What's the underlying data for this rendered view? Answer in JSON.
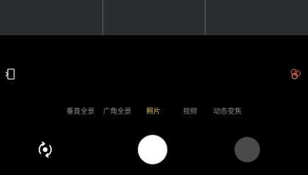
{
  "camera": {
    "modes": [
      {
        "label": "垂直全景"
      },
      {
        "label": "广角全景"
      },
      {
        "label": "照片"
      },
      {
        "label": "视频"
      },
      {
        "label": "动态变焦"
      }
    ],
    "active_mode": "照片",
    "colors": {
      "background": "#000000",
      "viewfinder": "#2a2e33",
      "mode_inactive": "#8d8d8d",
      "mode_active": "#e9c84a",
      "filter_icon": "#e0502a",
      "shutter": "#ffffff",
      "gallery_thumbnail": "#4a4a4a"
    },
    "icons": {
      "left": "exit-icon",
      "right": "filter-icon",
      "switch": "switch-camera-icon"
    }
  }
}
